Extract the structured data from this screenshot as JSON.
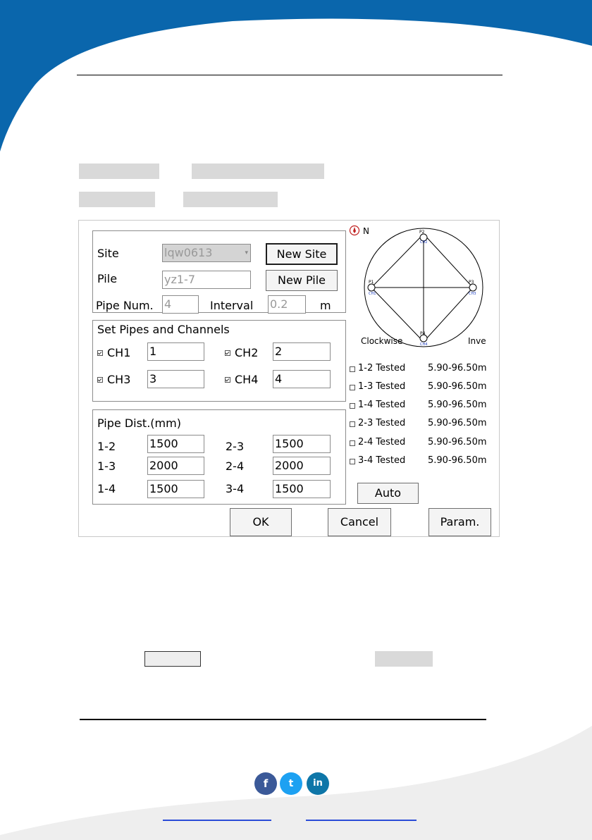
{
  "colors": {
    "brand_blue": "#0a66ac",
    "footer_gray": "#eeeeee",
    "highlight_gray": "#d9d9d9",
    "link_blue": "#2a4bd7"
  },
  "dialog": {
    "site_label": "Site",
    "site_value": "lqw0613",
    "new_site_label": "New Site",
    "pile_label": "Pile",
    "pile_value": "yz1-7",
    "new_pile_label": "New Pile",
    "pipe_num_label": "Pipe Num.",
    "pipe_num_value": "4",
    "interval_label": "Interval",
    "interval_value": "0.2",
    "interval_unit": "m",
    "channels_title": "Set Pipes and Channels",
    "channels": [
      {
        "label": "CH1",
        "value": "1",
        "checked": true
      },
      {
        "label": "CH2",
        "value": "2",
        "checked": true
      },
      {
        "label": "CH3",
        "value": "3",
        "checked": true
      },
      {
        "label": "CH4",
        "value": "4",
        "checked": true
      }
    ],
    "dist_title": "Pipe Dist.(mm)",
    "distances": [
      {
        "label": "1-2",
        "value": "1500"
      },
      {
        "label": "2-3",
        "value": "1500"
      },
      {
        "label": "1-3",
        "value": "2000"
      },
      {
        "label": "2-4",
        "value": "2000"
      },
      {
        "label": "1-4",
        "value": "1500"
      },
      {
        "label": "3-4",
        "value": "1500"
      }
    ],
    "compass_label": "N",
    "diagram": {
      "nodes": [
        {
          "label": "P1",
          "channel": "CH1"
        },
        {
          "label": "P2",
          "channel": "CH2"
        },
        {
          "label": "P3",
          "channel": "CH3"
        },
        {
          "label": "P4",
          "channel": "CH4"
        }
      ],
      "clockwise_label": "Clockwise",
      "inverse_label": "Inve"
    },
    "tested": [
      {
        "label": "1-2 Tested",
        "range": "5.90-96.50m",
        "checked": false
      },
      {
        "label": "1-3 Tested",
        "range": "5.90-96.50m",
        "checked": false
      },
      {
        "label": "1-4 Tested",
        "range": "5.90-96.50m",
        "checked": false
      },
      {
        "label": "2-3 Tested",
        "range": "5.90-96.50m",
        "checked": false
      },
      {
        "label": "2-4 Tested",
        "range": "5.90-96.50m",
        "checked": false
      },
      {
        "label": "3-4 Tested",
        "range": "5.90-96.50m",
        "checked": false
      }
    ],
    "auto_label": "Auto",
    "ok_label": "OK",
    "cancel_label": "Cancel",
    "param_label": "Param."
  },
  "footer": {
    "social": [
      {
        "icon": "facebook-icon",
        "glyph": "f",
        "color": "#3b5998"
      },
      {
        "icon": "twitter-icon",
        "glyph": "t",
        "color": "#1da1f2"
      },
      {
        "icon": "linkedin-icon",
        "glyph": "in",
        "color": "#0e76a8"
      }
    ]
  }
}
